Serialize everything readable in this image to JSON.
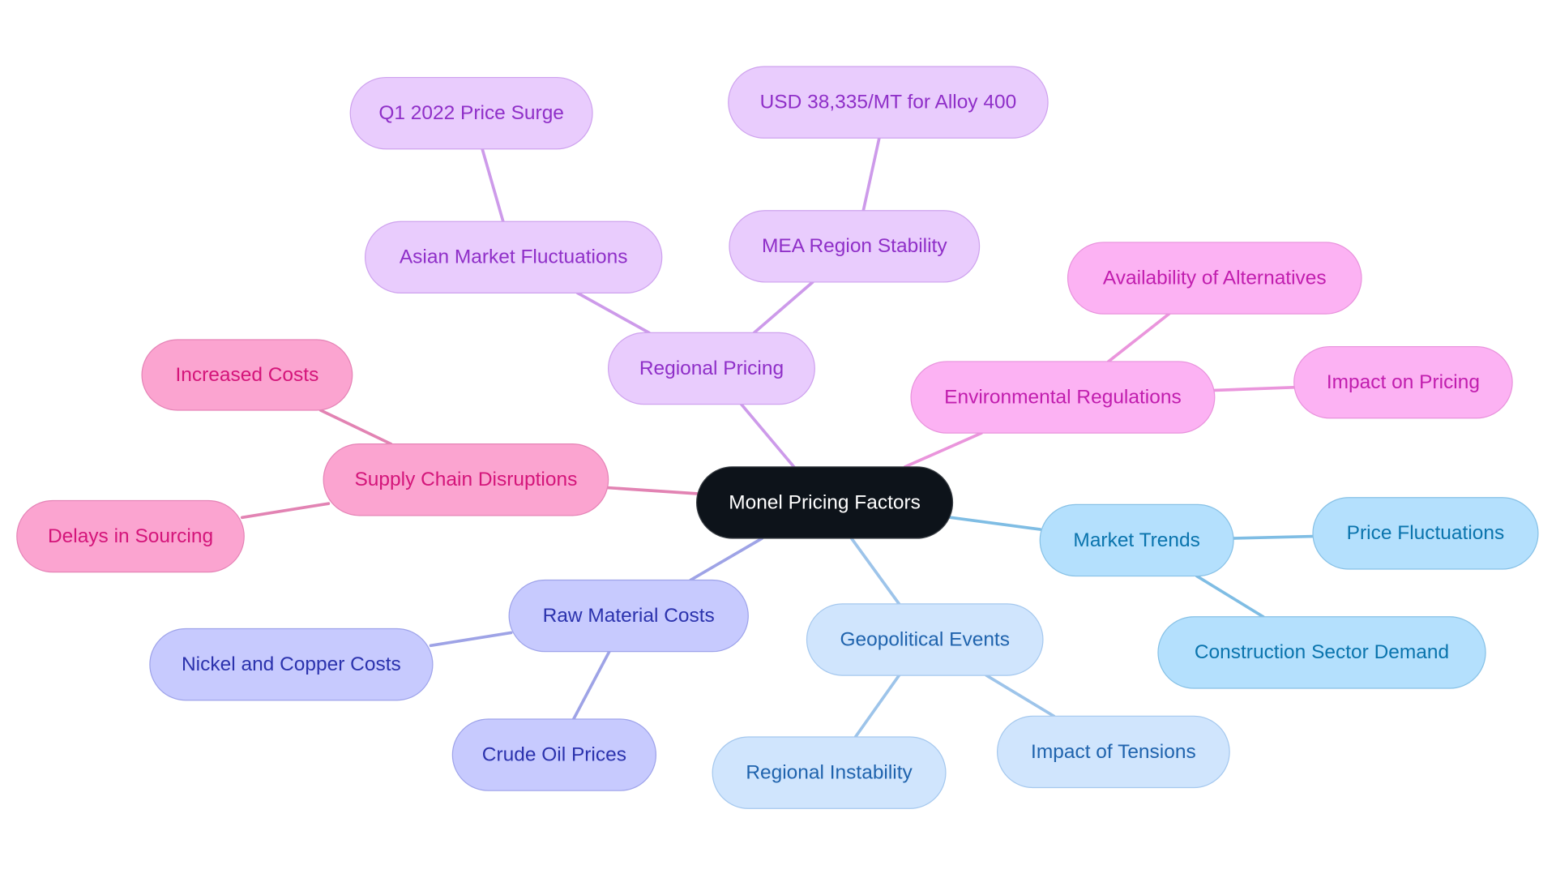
{
  "diagram": {
    "type": "mindmap",
    "root": {
      "id": "root",
      "label": "Monel Pricing Factors"
    },
    "branches": [
      {
        "id": "supply",
        "label": "Supply Chain Disruptions",
        "colors": {
          "fill": "#fba4d0",
          "stroke": "#e583b6",
          "text": "#d4157a",
          "edge": "#e283b3"
        },
        "children": [
          {
            "id": "increased-costs",
            "label": "Increased Costs"
          },
          {
            "id": "delays",
            "label": "Delays in Sourcing"
          }
        ]
      },
      {
        "id": "regional",
        "label": "Regional Pricing",
        "colors": {
          "fill": "#e9ccfd",
          "stroke": "#cea2ee",
          "text": "#8f2fc8",
          "edge": "#cd9aea"
        },
        "children": [
          {
            "id": "asian",
            "label": "Asian Market Fluctuations",
            "children": [
              {
                "id": "q1",
                "label": "Q1 2022 Price Surge"
              }
            ]
          },
          {
            "id": "mea",
            "label": "MEA Region Stability",
            "children": [
              {
                "id": "usd",
                "label": "USD 38,335/MT for Alloy 400"
              }
            ]
          }
        ]
      },
      {
        "id": "env",
        "label": "Environmental Regulations",
        "colors": {
          "fill": "#fcb2f3",
          "stroke": "#e892dc",
          "text": "#c11dae",
          "edge": "#ea95dc"
        },
        "children": [
          {
            "id": "alternatives",
            "label": "Availability of Alternatives"
          },
          {
            "id": "impact-pricing",
            "label": "Impact on Pricing"
          }
        ]
      },
      {
        "id": "market",
        "label": "Market Trends",
        "colors": {
          "fill": "#b4e0fd",
          "stroke": "#87c1e6",
          "text": "#0a74ad",
          "edge": "#7fbde4"
        },
        "children": [
          {
            "id": "price-fluct",
            "label": "Price Fluctuations"
          },
          {
            "id": "construction",
            "label": "Construction Sector Demand"
          }
        ]
      },
      {
        "id": "geo",
        "label": "Geopolitical Events",
        "colors": {
          "fill": "#d0e5fd",
          "stroke": "#a5c8ee",
          "text": "#1f63ad",
          "edge": "#9dc4ea"
        },
        "children": [
          {
            "id": "instability",
            "label": "Regional Instability"
          },
          {
            "id": "tensions",
            "label": "Impact of Tensions"
          }
        ]
      },
      {
        "id": "raw",
        "label": "Raw Material Costs",
        "colors": {
          "fill": "#c7cafe",
          "stroke": "#9ea3ea",
          "text": "#2b32ad",
          "edge": "#9ea3e6"
        },
        "children": [
          {
            "id": "nickel",
            "label": "Nickel and Copper Costs"
          },
          {
            "id": "crude",
            "label": "Crude Oil Prices"
          }
        ]
      }
    ],
    "root_colors": {
      "fill": "#0d131a",
      "stroke": "#3a3f45",
      "text": "#ffffff"
    }
  }
}
